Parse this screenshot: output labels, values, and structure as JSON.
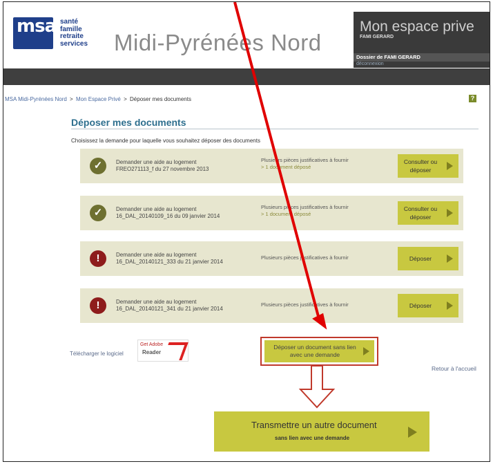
{
  "header": {
    "logo_letters": "msa",
    "brand_lines": [
      "santé",
      "famille",
      "retraite",
      "services"
    ],
    "region": "Midi-Pyrénées Nord",
    "espace": {
      "title": "Mon espace prive",
      "user": "FAMI GERARD",
      "dossier": "Dossier de FAMI GERARD",
      "logout": "déconnexion"
    }
  },
  "breadcrumb": {
    "items": [
      "MSA Midi-Pyrénées Nord",
      "Mon Espace Privé",
      "Déposer mes documents"
    ],
    "separator": ">"
  },
  "help_label": "?",
  "page": {
    "title": "Déposer mes documents",
    "intro": "Choisissez la demande pour laquelle vous souhaitez déposer des documents"
  },
  "requests": [
    {
      "status": "complete",
      "status_icon": "check-circle-icon",
      "status_glyph": "✓",
      "line1": "Demander une aide au logement",
      "line2": "FREO271113_f du 27 novembre 2013",
      "pieces": "Plusieurs pièces justificatives à fournir",
      "count": "> 1 document déposé",
      "action": "Consulter ou déposer"
    },
    {
      "status": "complete",
      "status_icon": "check-circle-icon",
      "status_glyph": "✓",
      "line1": "Demander une aide au logement",
      "line2": "16_DAL_20140109_16 du 09 janvier 2014",
      "pieces": "Plusieurs pièces justificatives à fournir",
      "count": "> 1 document déposé",
      "action": "Consulter ou déposer"
    },
    {
      "status": "missing",
      "status_icon": "exclamation-circle-icon",
      "status_glyph": "!",
      "line1": "Demander une aide au logement",
      "line2": "16_DAL_20140121_333 du 21 janvier 2014",
      "pieces": "Plusieurs pièces justificatives à fournir",
      "count": "",
      "action": "Déposer"
    },
    {
      "status": "missing",
      "status_icon": "exclamation-circle-icon",
      "status_glyph": "!",
      "line1": "Demander une aide au logement",
      "line2": "16_DAL_20140121_341 du 21 janvier 2014",
      "pieces": "Plusieurs pièces justificatives à fournir",
      "count": "",
      "action": "Déposer"
    }
  ],
  "footer": {
    "download_label": "Télécharger le logiciel",
    "adobe_get": "Get Adobe",
    "adobe_reader": "Reader",
    "depot_button": "Déposer un document sans lien avec une demande",
    "back_link": "Retour à l'accueil"
  },
  "big_button": {
    "main": "Transmettre un autre document",
    "sub": "sans lien avec une demande"
  },
  "colors": {
    "brand_blue": "#1f3f8a",
    "title_blue": "#2e6f8e",
    "card_bg": "#e7e6cf",
    "button_olive": "#c8c840",
    "ok_green": "#6e7030",
    "warn_red": "#8e1c1c",
    "annotation_red": "#e00000"
  }
}
